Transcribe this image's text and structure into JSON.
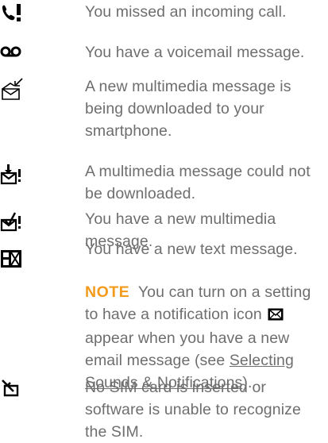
{
  "items": [
    {
      "icon": "missed-call-icon",
      "text": "You missed an incoming call."
    },
    {
      "icon": "voicemail-icon",
      "text": "You have a voicemail message."
    },
    {
      "icon": "mms-downloading-icon",
      "text": "A new multimedia message is being downloaded to your smartphone."
    },
    {
      "icon": "mms-download-failed-icon",
      "text": "A multimedia message could not be downloaded."
    },
    {
      "icon": "new-mms-icon",
      "text": "You have a new multimedia message."
    },
    {
      "icon": "new-text-message-icon",
      "text": "You have a new text message."
    },
    {
      "icon": "no-sim-icon",
      "text": "No SIM card is inserted or software is unable to recognize the SIM."
    }
  ],
  "note": {
    "label": "NOTE",
    "text_before": "You can turn on a setting to have a notification icon",
    "icon": "email-envelope-icon",
    "text_after": "appear when you have a new email message (see",
    "link": "Selecting Sounds & Notifications",
    "text_end": ")."
  },
  "colors": {
    "note_accent": "#f29b1d",
    "body_text": "#6e6e6e",
    "icon": "#000000"
  }
}
